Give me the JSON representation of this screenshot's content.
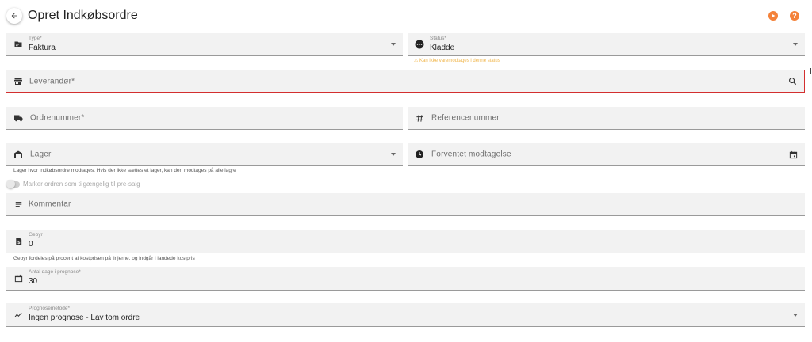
{
  "header": {
    "title": "Opret Indkøbsordre",
    "back_icon": "arrow-left-icon",
    "play_icon": "play-icon",
    "help_icon": "help-icon",
    "help_glyph": "?",
    "accent_color": "#f4823a"
  },
  "fields": {
    "type": {
      "label": "Type*",
      "value": "Faktura",
      "icon": "document-icon"
    },
    "status": {
      "label": "Status*",
      "value": "Kladde",
      "icon": "more-horizontal-circle-icon",
      "warning": "⚠ Kan ikke varemodtages i denne status"
    },
    "supplier": {
      "placeholder": "Leverandør*",
      "icon": "store-icon",
      "error_color": "#d32f2f"
    },
    "order_number": {
      "placeholder": "Ordrenummer*",
      "icon": "truck-icon"
    },
    "reference": {
      "placeholder": "Referencenummer",
      "icon": "hash-icon"
    },
    "warehouse": {
      "placeholder": "Lager",
      "icon": "warehouse-icon",
      "hint": "Lager hvor indkøbsordre modtages. Hvis der ikke sættes et lager, kan den modtages på alle lagre"
    },
    "expected": {
      "placeholder": "Forventet modtagelse",
      "icon": "clock-icon"
    },
    "presale": {
      "label": "Marker ordren som tilgængelig til pre-salg",
      "checked": false
    },
    "comment": {
      "placeholder": "Kommentar",
      "icon": "list-icon"
    },
    "fee": {
      "label": "Gebyr",
      "value": "0",
      "icon": "currency-icon",
      "hint": "Gebyr fordeles på procent af kostprisen på linjerne, og indgår i landede kostpris"
    },
    "forecast_days": {
      "label": "Antal dage i prognose*",
      "value": "30",
      "icon": "calendar-icon"
    },
    "forecast_method": {
      "label": "Prognosemetode*",
      "value": "Ingen prognose - Lav tom ordre",
      "icon": "trend-icon"
    }
  }
}
